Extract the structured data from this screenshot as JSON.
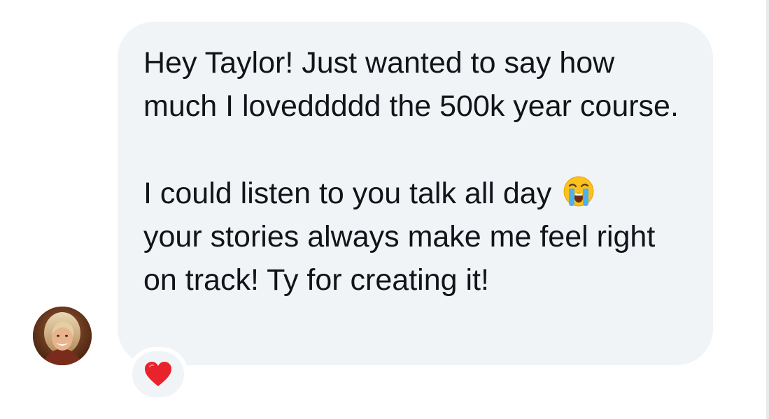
{
  "message": {
    "paragraph_1": "Hey Taylor! Just wanted to say how much I loveddddd the 500k year course.",
    "paragraph_2_before_emoji": "I could listen to you talk all day ",
    "emoji_icon": "loudly-crying-face-icon",
    "paragraph_2_after_emoji": "your stories always make me feel right on track! Ty for creating it!"
  },
  "reaction": {
    "icon": "red-heart-icon",
    "color": "#e8232b"
  },
  "colors": {
    "bubble_background": "#f1f4f6",
    "text": "#111418",
    "page_background": "#ffffff"
  }
}
